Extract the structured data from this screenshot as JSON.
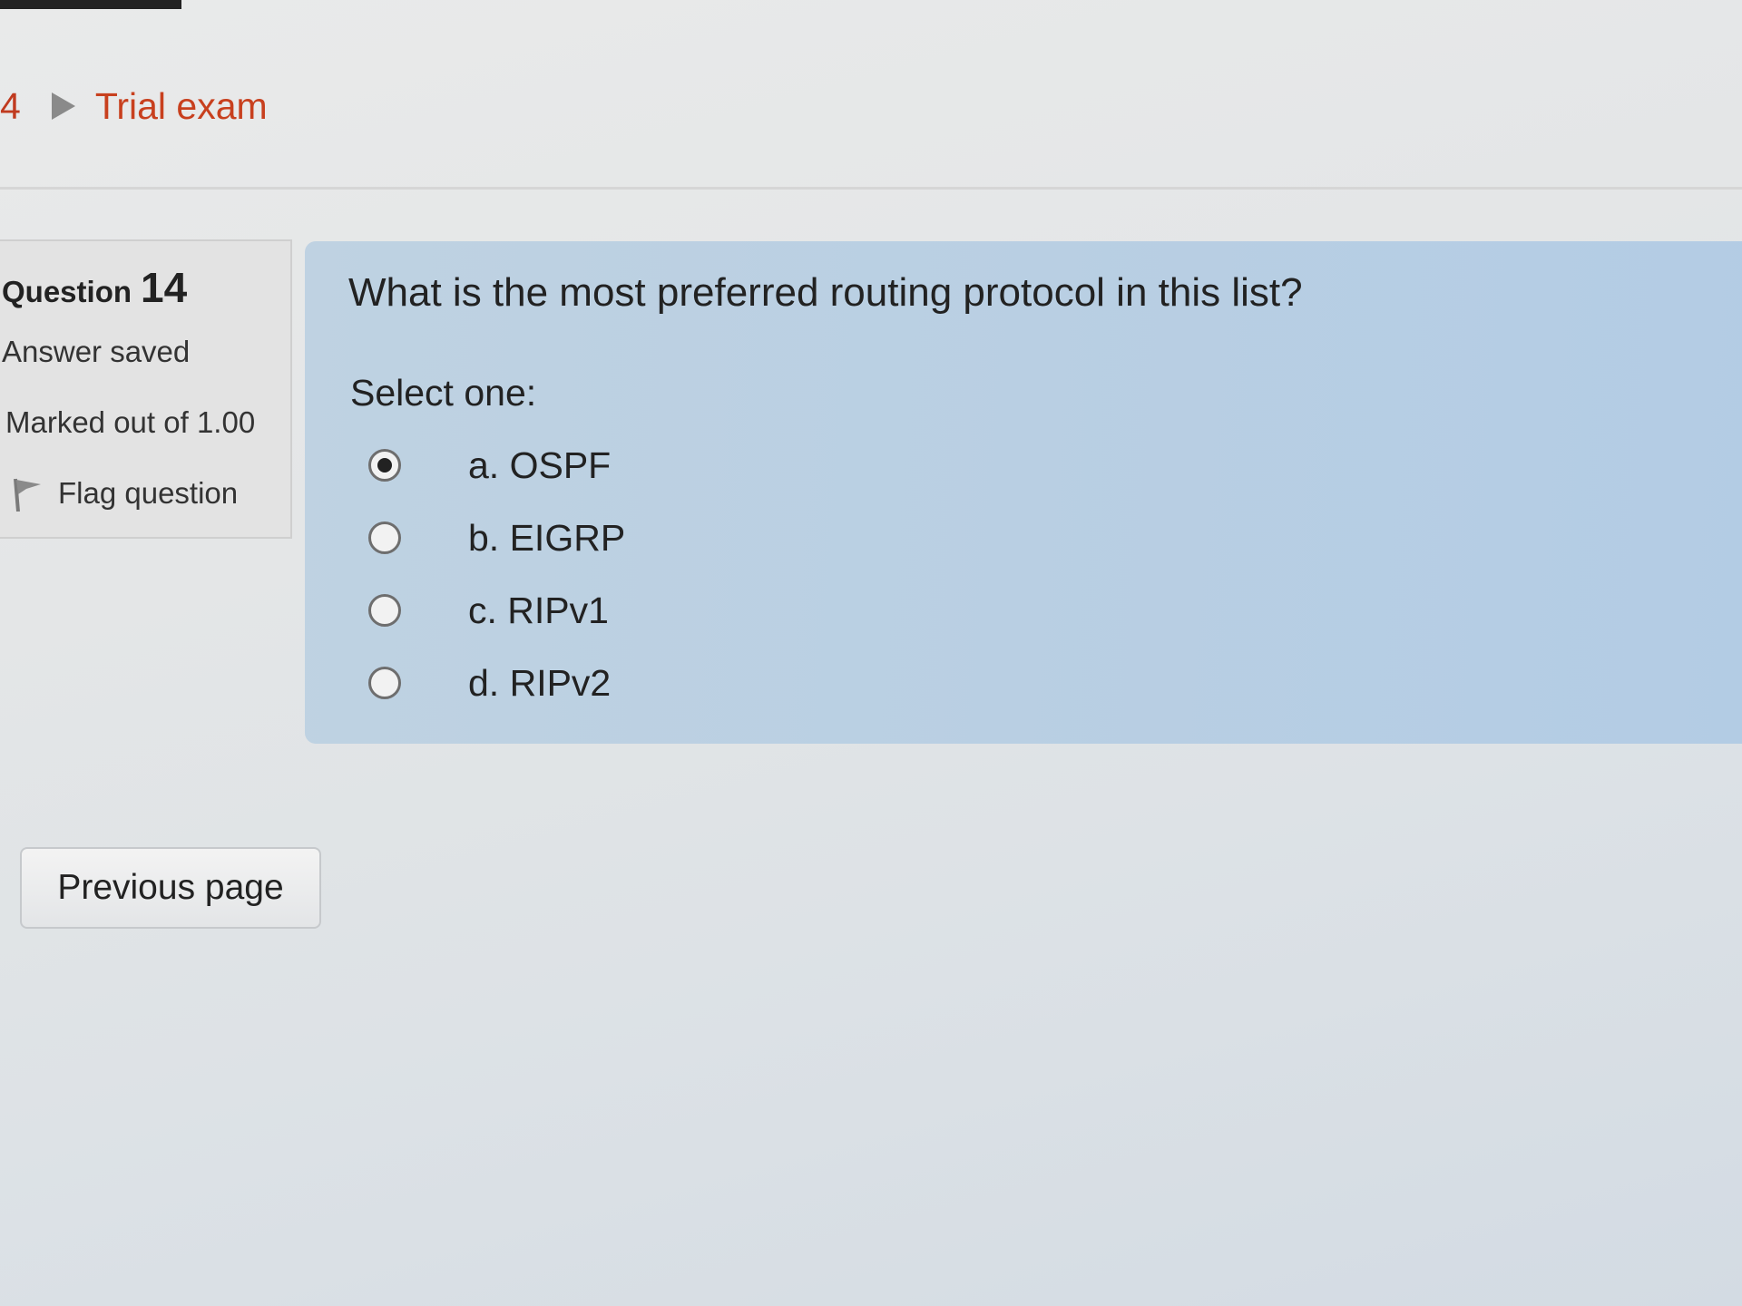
{
  "breadcrumb": {
    "previous_fragment": "4",
    "separator_icon": "triangle-right-icon",
    "current": "Trial exam"
  },
  "question_info": {
    "label": "Question",
    "number": "14",
    "state": "Answer saved",
    "grade": "Marked out of 1.00",
    "flag_label": "Flag question",
    "flag_icon": "flag-icon"
  },
  "question": {
    "text": "What is the most preferred routing protocol in this list?",
    "prompt": "Select one:",
    "options": [
      {
        "label": "a. OSPF",
        "selected": true
      },
      {
        "label": "b. EIGRP",
        "selected": false
      },
      {
        "label": "c. RIPv1",
        "selected": false
      },
      {
        "label": "d. RIPv2",
        "selected": false
      }
    ]
  },
  "navigation": {
    "previous_label": "Previous page"
  },
  "colors": {
    "link": "#c8401e",
    "question_background": "#b9cfe3",
    "info_background": "#e3e3e3"
  }
}
